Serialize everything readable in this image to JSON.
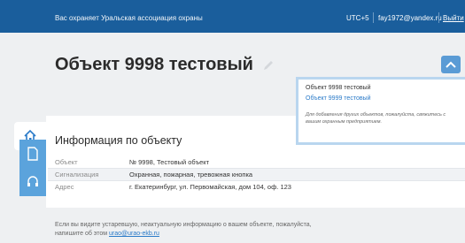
{
  "topbar": {
    "protection_text": "Вас охраняет Уральская ассоциация охраны",
    "timezone": "UTC+5",
    "email": "fay1972@yandex.ru",
    "logout": "Выйти"
  },
  "page": {
    "title": "Объект 9998 тестовый"
  },
  "object_switcher": {
    "current": "Объект 9998 тестовый",
    "other": "Объект 9999 тестовый",
    "hint": "Для добавления других объектов, пожалуйста, свяжитесь с вашим охранным предприятием."
  },
  "info": {
    "heading": "Информация по объекту",
    "rows": [
      {
        "label": "Объект",
        "value": "№ 9998, Тестовый объект"
      },
      {
        "label": "Сигнализация",
        "value": "Охранная, пожарная, тревожная кнопка"
      },
      {
        "label": "Адрес",
        "value": "г. Екатеринбург, ул. Первомайская, дом 104, оф. 123"
      }
    ]
  },
  "footer": {
    "text": "Если вы видите устаревшую, неактуальную информацию о вашем объекте, пожалуйста, напишите об этом",
    "link": "urao@urao-ekb.ru"
  },
  "sidebar": {
    "tabs": [
      {
        "icon": "home-icon",
        "active": true
      },
      {
        "icon": "document-icon",
        "active": false
      },
      {
        "icon": "headset-icon",
        "active": false
      }
    ]
  },
  "colors": {
    "topbar": "#1a5e9c",
    "accent": "#5ba3dc",
    "link": "#2a7ac8"
  }
}
